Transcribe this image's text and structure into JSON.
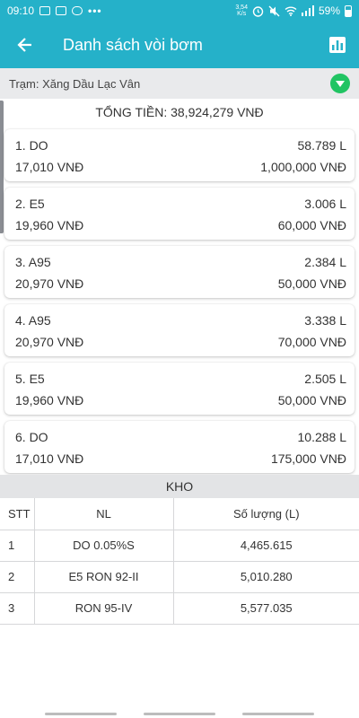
{
  "status_bar": {
    "time": "09:10",
    "net_speed_value": "3,54",
    "net_speed_unit": "K/s",
    "battery": "59%"
  },
  "app_bar": {
    "title": "Danh sách vòi bơm",
    "back_icon": "arrow-left-icon",
    "chart_icon": "bar-chart-icon"
  },
  "station": {
    "label": "Trạm: Xăng Dầu Lạc Vân"
  },
  "total": {
    "text": "TỔNG TIỀN: 38,924,279 VNĐ"
  },
  "pumps": [
    {
      "name": "1. DO",
      "liters": "58.789 L",
      "price": "17,010 VNĐ",
      "amount": "1,000,000 VNĐ"
    },
    {
      "name": "2. E5",
      "liters": "3.006 L",
      "price": "19,960 VNĐ",
      "amount": "60,000 VNĐ"
    },
    {
      "name": "3. A95",
      "liters": "2.384 L",
      "price": "20,970 VNĐ",
      "amount": "50,000 VNĐ"
    },
    {
      "name": "4. A95",
      "liters": "3.338 L",
      "price": "20,970 VNĐ",
      "amount": "70,000 VNĐ"
    },
    {
      "name": "5. E5",
      "liters": "2.505 L",
      "price": "19,960 VNĐ",
      "amount": "50,000 VNĐ"
    },
    {
      "name": "6. DO",
      "liters": "10.288 L",
      "price": "17,010 VNĐ",
      "amount": "175,000 VNĐ"
    }
  ],
  "kho": {
    "title": "KHO",
    "columns": [
      "STT",
      "NL",
      "Số lượng (L)"
    ],
    "rows": [
      [
        "1",
        "DO 0.05%S",
        "4,465.615"
      ],
      [
        "2",
        "E5 RON 92-II",
        "5,010.280"
      ],
      [
        "3",
        "RON 95-IV",
        "5,577.035"
      ]
    ]
  },
  "colors": {
    "primary": "#25b1c9",
    "dropdown": "#21c463",
    "section_bg": "#e9eaec"
  }
}
